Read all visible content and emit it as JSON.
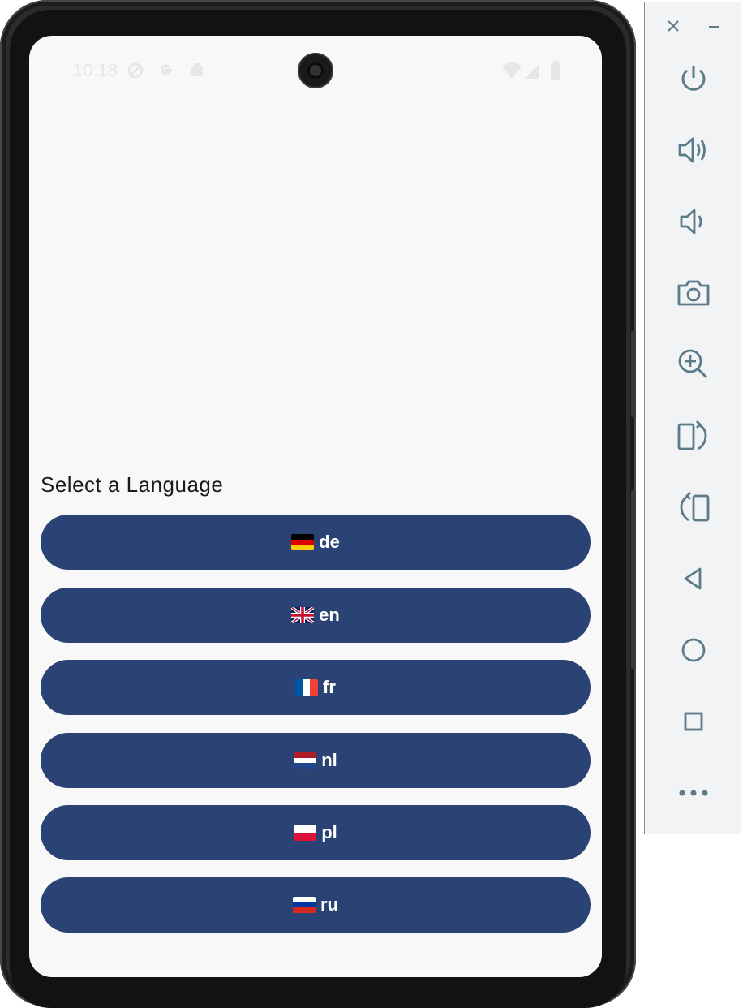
{
  "status_bar": {
    "time": "10:18"
  },
  "screen": {
    "heading": "Select a Language",
    "languages": [
      {
        "code": "de",
        "flag": "germany-flag-icon"
      },
      {
        "code": "en",
        "flag": "uk-flag-icon"
      },
      {
        "code": "fr",
        "flag": "france-flag-icon"
      },
      {
        "code": "nl",
        "flag": "netherlands-flag-icon"
      },
      {
        "code": "pl",
        "flag": "poland-flag-icon"
      },
      {
        "code": "ru",
        "flag": "russia-flag-icon"
      }
    ]
  },
  "emulator_panel": {
    "window_controls": [
      "close-icon",
      "minimize-icon"
    ],
    "tools": [
      "power-icon",
      "volume-up-icon",
      "volume-down-icon",
      "camera-icon",
      "zoom-icon",
      "rotate-left-icon",
      "rotate-right-icon",
      "back-icon",
      "home-icon",
      "overview-icon",
      "more-icon"
    ]
  },
  "colors": {
    "button_bg": "#2b4274",
    "screen_bg": "#f8f8f9",
    "panel_icon": "#5b7a8a"
  }
}
